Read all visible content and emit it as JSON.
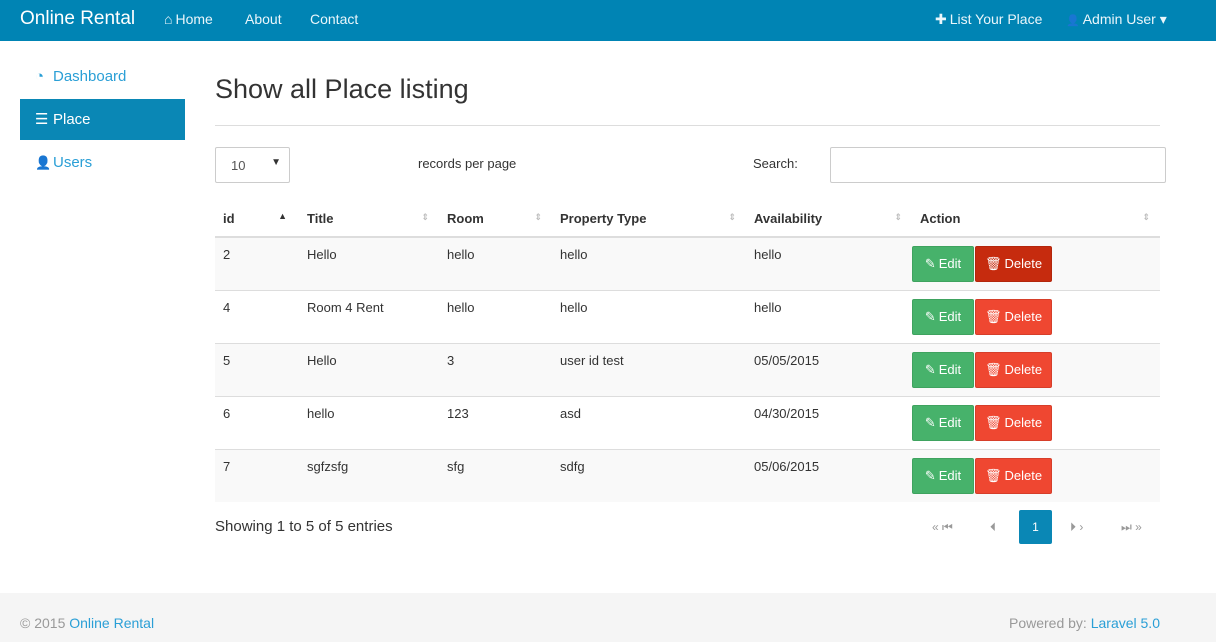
{
  "navbar": {
    "brand": "Online Rental",
    "links": [
      {
        "icon": "home-icon",
        "glyph": "⌂",
        "label": "Home"
      },
      {
        "label": "About"
      },
      {
        "label": "Contact"
      }
    ],
    "list_place": {
      "icon": "plus-icon",
      "glyph": "✚",
      "label": "List Your Place"
    },
    "user_menu": {
      "icon": "user-icon",
      "glyph": "👤",
      "label": "Admin User",
      "caret": "▾"
    }
  },
  "sidebar": {
    "items": [
      {
        "icon": "dashboard-icon",
        "glyph": "◔",
        "label": "Dashboard"
      },
      {
        "icon": "list-icon",
        "glyph": "☰",
        "label": "Place"
      },
      {
        "icon": "user-icon",
        "glyph": "👤",
        "label": "Users"
      }
    ]
  },
  "main": {
    "title": "Show all Place listing",
    "length": {
      "value": "10",
      "label": "records per page"
    },
    "search": {
      "label": "Search:",
      "value": ""
    },
    "columns": [
      "id",
      "Title",
      "Room",
      "Property Type",
      "Availability",
      "Action"
    ],
    "rows": [
      {
        "id": "2",
        "title": "Hello",
        "room": "hello",
        "type": "hello",
        "availability": "hello"
      },
      {
        "id": "4",
        "title": "Room 4 Rent",
        "room": "hello",
        "type": "hello",
        "availability": "hello"
      },
      {
        "id": "5",
        "title": "Hello",
        "room": "3",
        "type": "user id test",
        "availability": "05/05/2015"
      },
      {
        "id": "6",
        "title": "hello",
        "room": "123",
        "type": "asd",
        "availability": "04/30/2015"
      },
      {
        "id": "7",
        "title": "sgfzsfg",
        "room": "sfg",
        "type": "sdfg",
        "availability": "05/06/2015"
      }
    ],
    "edit_label": "Edit",
    "delete_label": "Delete",
    "info": "Showing 1 to 5 of 5 entries",
    "pagination": {
      "first": "« ⏮",
      "prev": "⏴",
      "current": "1",
      "next": "⏵ ›",
      "last": "⏭ »"
    }
  },
  "footer": {
    "copyright": "© 2015",
    "brand_link": "Online Rental",
    "powered_label": "Powered by:",
    "powered_link": "Laravel 5.0"
  },
  "colors": {
    "navbar": "#0084b4",
    "accent": "#2a9fd6",
    "edit": "#47b26b",
    "delete": "#ef4731"
  }
}
